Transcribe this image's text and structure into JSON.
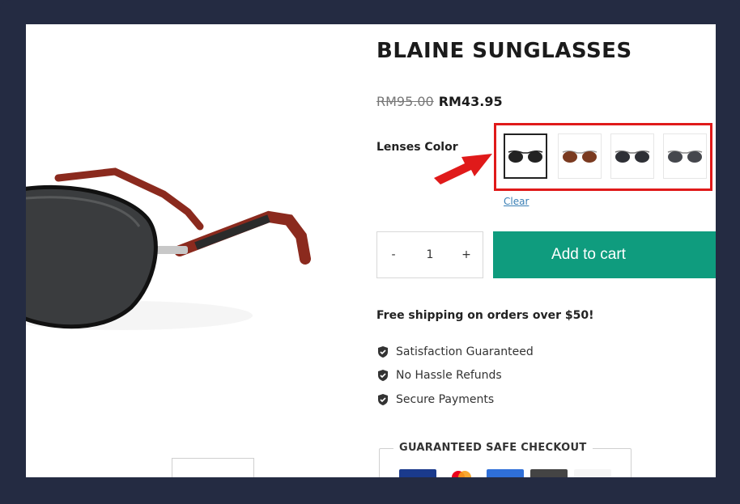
{
  "product": {
    "title": "BLAINE SUNGLASSES",
    "old_price": "RM95.00",
    "new_price": "RM43.95"
  },
  "variant": {
    "label": "Lenses Color",
    "clear_label": "Clear",
    "options": [
      {
        "name": "black-lens",
        "selected": true
      },
      {
        "name": "brown-lens",
        "selected": false
      },
      {
        "name": "dark-grey-lens",
        "selected": false
      },
      {
        "name": "grey-lens",
        "selected": false
      }
    ]
  },
  "quantity": {
    "minus": "-",
    "value": "1",
    "plus": "+"
  },
  "cart": {
    "add_label": "Add to cart",
    "accent": "#0f9c7e"
  },
  "shipping": {
    "text": "Free shipping on orders over $50!"
  },
  "benefits": [
    {
      "icon": "shield-check-icon",
      "label": "Satisfaction Guaranteed"
    },
    {
      "icon": "shield-check-icon",
      "label": "No Hassle Refunds"
    },
    {
      "icon": "shield-check-icon",
      "label": "Secure Payments"
    }
  ],
  "checkout": {
    "title": "GUARANTEED SAFE CHECKOUT",
    "payment_icons": [
      "visa-icon",
      "mastercard-icon",
      "amex-icon",
      "card-icon",
      "paypal-icon"
    ]
  },
  "annotation": {
    "highlight_color": "#e01a1a"
  }
}
